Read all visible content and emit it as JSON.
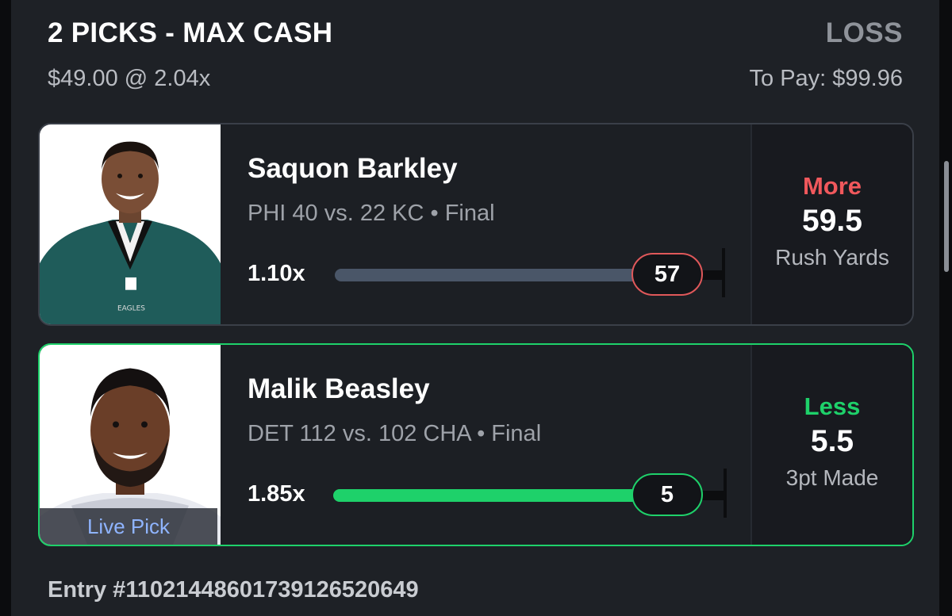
{
  "header": {
    "title": "2 PICKS - MAX CASH",
    "result": "LOSS",
    "stake": "$49.00 @ 2.04x",
    "to_pay": "To Pay: $99.96"
  },
  "picks": [
    {
      "player": "Saquon Barkley",
      "game": "PHI 40 vs. 22 KC • Final",
      "multiplier": "1.10x",
      "actual": "57",
      "progress_fraction": 0.96,
      "direction": "More",
      "line": "59.5",
      "stat": "Rush Yards",
      "jersey_text": "EAGLES",
      "status": "loss"
    },
    {
      "player": "Malik Beasley",
      "game": "DET 112 vs. 102 CHA • Final",
      "multiplier": "1.85x",
      "actual": "5",
      "progress_fraction": 0.91,
      "direction": "Less",
      "line": "5.5",
      "stat": "3pt Made",
      "badge": "Live Pick",
      "status": "win"
    }
  ],
  "entry_id": "Entry #1102144860173912652064​9",
  "colors": {
    "accent_green": "#1ed16a",
    "accent_red": "#f0585c",
    "progress_gray": "#4a5668"
  }
}
